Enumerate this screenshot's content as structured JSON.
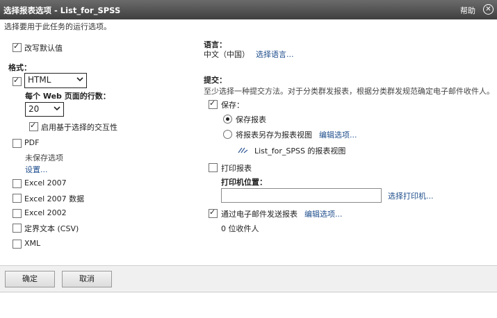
{
  "window": {
    "title": "选择报表选项 - List_for_SPSS",
    "help": "帮助"
  },
  "instruction": "选择要用于此任务的运行选项。",
  "override": {
    "label": "改写默认值",
    "checked": true
  },
  "format": {
    "heading": "格式：",
    "html": {
      "checked": true,
      "select_value": "HTML"
    },
    "rows_label": "每个 Web 页面的行数：",
    "rows_value": "20",
    "interactive": {
      "label": "启用基于选择的交互性",
      "checked": true
    },
    "pdf": {
      "label": "PDF",
      "checked": false,
      "note": "未保存选项",
      "settings_link": "设置..."
    },
    "excel2007": {
      "label": "Excel 2007",
      "checked": false
    },
    "excel2007data": {
      "label": "Excel 2007 数据",
      "checked": false
    },
    "excel2002": {
      "label": "Excel 2002",
      "checked": false
    },
    "csv": {
      "label": "定界文本 (CSV)",
      "checked": false
    },
    "xml": {
      "label": "XML",
      "checked": false
    }
  },
  "language": {
    "heading": "语言：",
    "value": "中文（中国）",
    "link": "选择语言..."
  },
  "delivery": {
    "heading": "提交：",
    "description": "至少选择一种提交方法。对于分类群发报表，根据分类群发规范确定电子邮件收件人。",
    "save": {
      "label": "保存：",
      "checked": true
    },
    "save_report": {
      "label": "保存报表",
      "selected": true
    },
    "save_as_view": {
      "label": "将报表另存为报表视图",
      "selected": false,
      "edit_link": "编辑选项..."
    },
    "view_name": "List_for_SPSS 的报表视图",
    "print": {
      "label": "打印报表",
      "checked": false
    },
    "printer_location_label": "打印机位置：",
    "printer_value": "",
    "select_printer_link": "选择打印机...",
    "email": {
      "label": "通过电子邮件发送报表",
      "checked": true,
      "edit_link": "编辑选项..."
    },
    "recipients": "0 位收件人"
  },
  "buttons": {
    "ok": "确定",
    "cancel": "取消"
  }
}
